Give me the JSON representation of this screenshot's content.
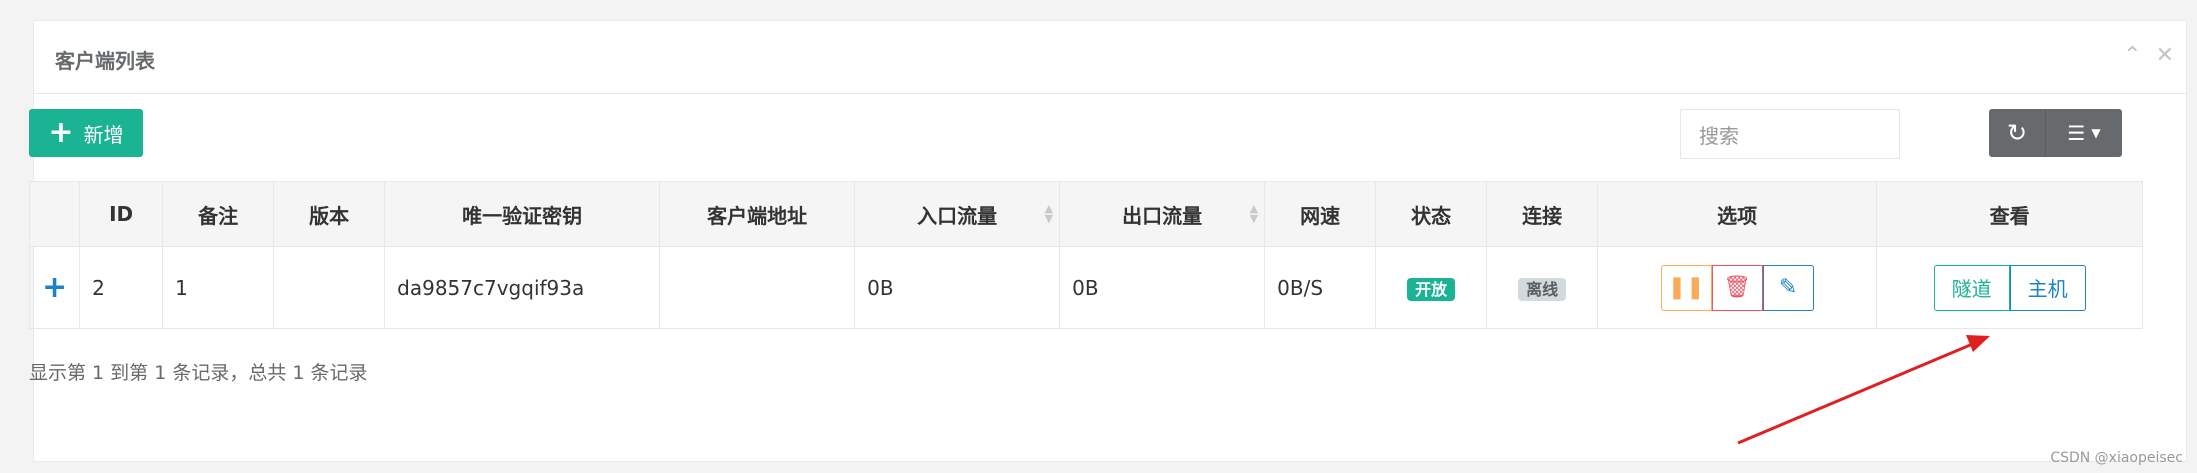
{
  "panel": {
    "title": "客户端列表",
    "collapse_icon": "chevron-up-icon",
    "close_icon": "close-icon"
  },
  "toolbar": {
    "add_label": "新增",
    "search_placeholder": "搜索",
    "refresh_icon": "refresh-icon",
    "columns_icon": "list-icon"
  },
  "table": {
    "headers": [
      "ID",
      "备注",
      "版本",
      "唯一验证密钥",
      "客户端地址",
      "入口流量",
      "出口流量",
      "网速",
      "状态",
      "连接",
      "选项",
      "查看"
    ],
    "rows": [
      {
        "id": "2",
        "remark": "1",
        "version": "",
        "key": "da9857c7vgqif93a",
        "address": "",
        "in_flow": "0B",
        "out_flow": "0B",
        "speed": "0B/S",
        "status": "开放",
        "connection": "离线",
        "view_tunnel": "隧道",
        "view_host": "主机"
      }
    ]
  },
  "footer": {
    "info": "显示第 1 到第 1 条记录，总共 1 条记录"
  },
  "watermark": "CSDN @xiaopeisec",
  "colors": {
    "primary": "#1ab394",
    "info": "#1c84c6",
    "warning": "#f8ac59",
    "danger": "#ed5565",
    "annotation_arrow": "#e02020"
  }
}
